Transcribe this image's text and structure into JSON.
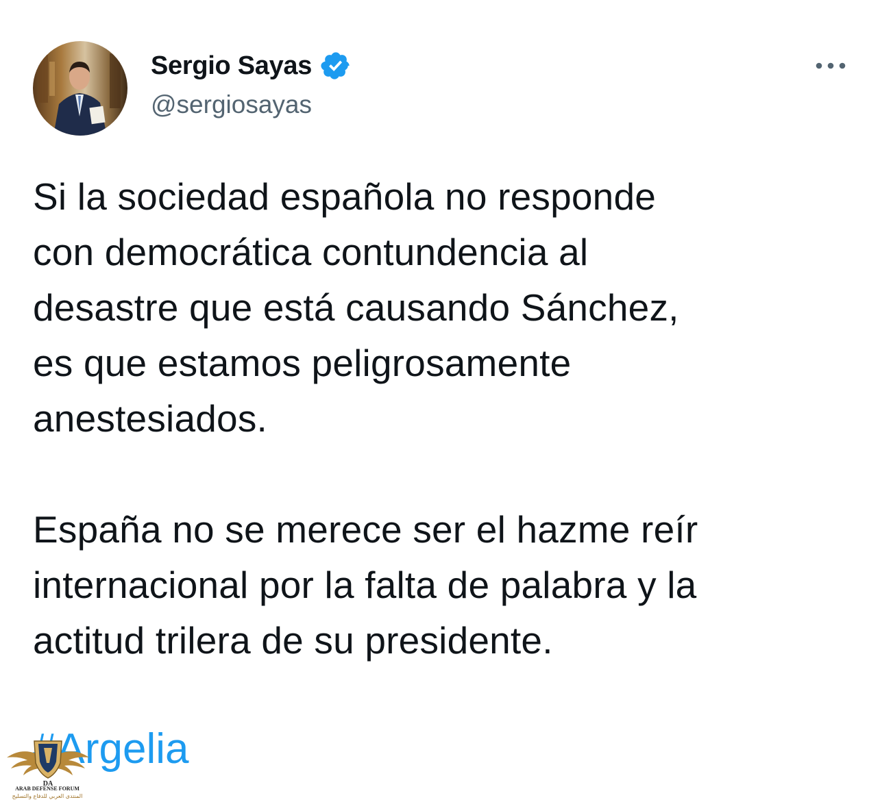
{
  "user": {
    "display_name": "Sergio Sayas",
    "handle": "@sergiosayas",
    "verified": true
  },
  "tweet": {
    "paragraphs": [
      [
        "Si la sociedad española no responde",
        "con democrática contundencia al",
        "desastre que está causando Sánchez,",
        "es que estamos peligrosamente",
        "anestesiados."
      ],
      [
        "España no se merece ser el hazme reír",
        "internacional por la falta de palabra y la",
        "actitud trilera de su presidente."
      ]
    ],
    "hashtag": "#Argelia"
  },
  "watermark": {
    "emblem": "DA",
    "title": "ARAB DEFENSE FORUM",
    "subtitle_ar": "المنتدى العربي للدفاع والتسليح"
  },
  "colors": {
    "text": "#0f1419",
    "secondary": "#536471",
    "accent": "#1d9bf0"
  },
  "icons": {
    "verified": "verified-badge-icon",
    "more": "more-options-icon"
  }
}
